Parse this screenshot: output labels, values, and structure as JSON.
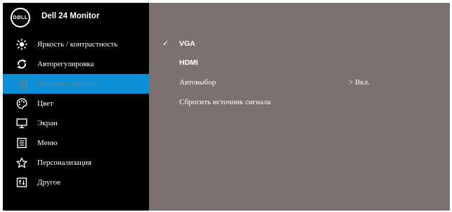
{
  "header": {
    "logo_text": "DØLL",
    "monitor_name": "Dell 24 Monitor"
  },
  "sidebar": {
    "items": [
      {
        "label": "Яркость / контрастность",
        "icon": "brightness-icon"
      },
      {
        "label": "Авторегулировка",
        "icon": "auto-adjust-icon"
      },
      {
        "label": "Источник сигнала",
        "icon": "input-source-icon",
        "selected": true
      },
      {
        "label": "Цвет",
        "icon": "color-icon"
      },
      {
        "label": "Экран",
        "icon": "display-icon"
      },
      {
        "label": "Меню",
        "icon": "menu-icon"
      },
      {
        "label": "Персонализация",
        "icon": "star-icon"
      },
      {
        "label": "Другое",
        "icon": "other-icon"
      }
    ]
  },
  "content": {
    "options": [
      {
        "label": "VGA",
        "checked": true
      },
      {
        "label": "HDMI",
        "checked": false
      },
      {
        "label": "Автовыбор",
        "value": "> Вкл."
      },
      {
        "label": "Сбросить  источник сигнала"
      }
    ],
    "check_glyph": "✓"
  },
  "colors": {
    "panel_bg": "#000000",
    "content_bg": "#7b7171",
    "selected_bg": "#0b8fd6",
    "selected_text": "#7a7a7a",
    "text": "#ffffff"
  }
}
